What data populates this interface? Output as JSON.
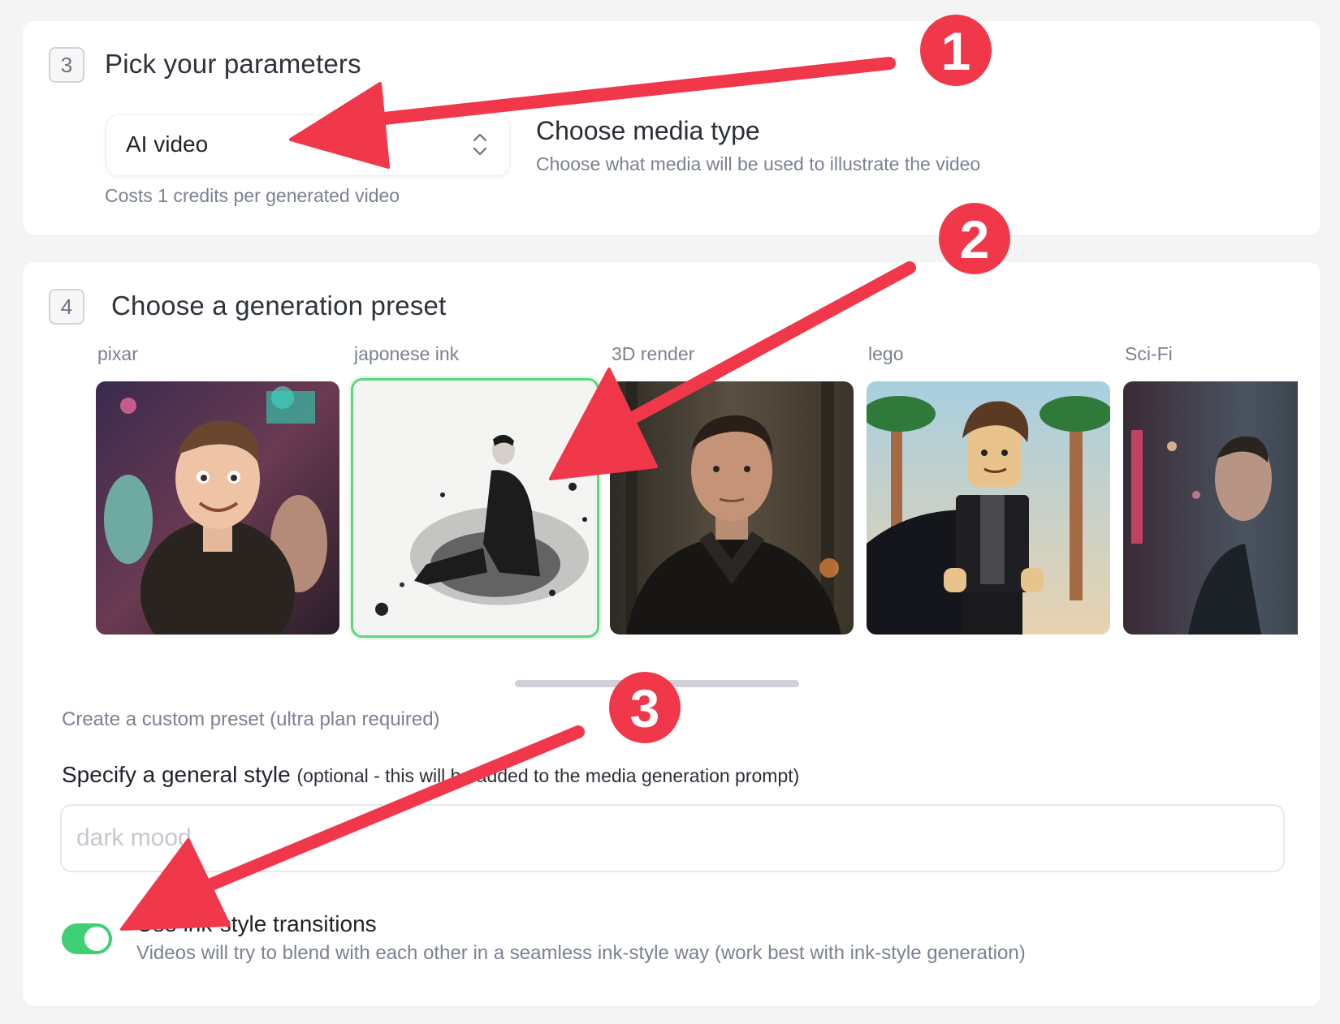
{
  "step3": {
    "number": "3",
    "title": "Pick your parameters",
    "select_value": "AI video",
    "cost_note": "Costs 1 credits per generated video",
    "media_title": "Choose media type",
    "media_desc": "Choose what media will be used to illustrate the video"
  },
  "step4": {
    "number": "4",
    "title": "Choose a generation preset",
    "presets": [
      {
        "label": "pixar",
        "selected": false
      },
      {
        "label": "japonese ink",
        "selected": true
      },
      {
        "label": "3D render",
        "selected": false
      },
      {
        "label": "lego",
        "selected": false
      },
      {
        "label": "Sci-Fi",
        "selected": false
      }
    ],
    "custom_preset_link": "Create a custom preset (ultra plan required)",
    "style_label": "Specify a general style",
    "style_label_note": "(optional - this will be added to the media generation prompt)",
    "style_placeholder": "dark mood",
    "toggle_on": true,
    "toggle_title": "Use ink-style transitions",
    "toggle_desc": "Videos will try to blend with each other in a seamless ink-style way (work best with ink-style generation)"
  },
  "annotations": {
    "color": "#f0384a",
    "markers": [
      "1",
      "2",
      "3"
    ]
  }
}
